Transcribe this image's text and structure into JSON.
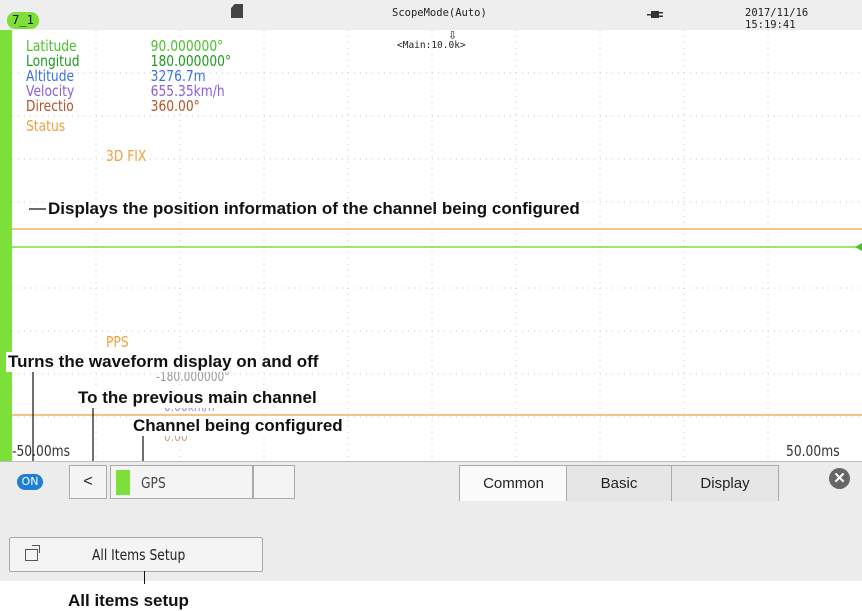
{
  "status_bar": {
    "channel_tag": "7_1",
    "scope_mode": "ScopeMode(Auto)",
    "datetime": "2017/11/16 15:19:41"
  },
  "waveform": {
    "main_label": "<Main:10.0k>",
    "gps_rows": [
      {
        "label": "Latitude",
        "value": "90.000000°",
        "color": "#4cc02c"
      },
      {
        "label": "Longitud",
        "value": "180.000000°",
        "color": "#1e9a1e"
      },
      {
        "label": "Altitude",
        "value": "3276.7m",
        "color": "#3a6fe0"
      },
      {
        "label": "Velocity",
        "value": "655.35km/h",
        "color": "#8a5fd8"
      },
      {
        "label": "Directio",
        "value": "360.00°",
        "color": "#b5522a"
      }
    ],
    "status_label": "Status",
    "fix_text": "3D FIX",
    "pps_text": "PPS",
    "ghost_values": [
      "-180.000000°",
      "0.00km/h",
      "0.00°"
    ],
    "time_left": "-50.00ms",
    "time_right": "50.00ms"
  },
  "annotations": {
    "position_info": "Displays the position information of the channel being configured",
    "waveform_toggle": "Turns the waveform display on and off",
    "previous_channel": "To the previous main channel",
    "channel_configured": "Channel being configured",
    "all_items": "All items setup"
  },
  "toolbar": {
    "on_label": "ON",
    "prev_label": "<",
    "channel_name": "GPS",
    "tabs": [
      "Common",
      "Basic",
      "Display"
    ],
    "active_tab": "Common",
    "close_icon": "close-icon"
  },
  "panel": {
    "all_items_label": "All Items Setup"
  },
  "colors": {
    "channel_green": "#7ddf3a",
    "orange": "#f0a040",
    "accent_blue": "#1e7fd8"
  }
}
